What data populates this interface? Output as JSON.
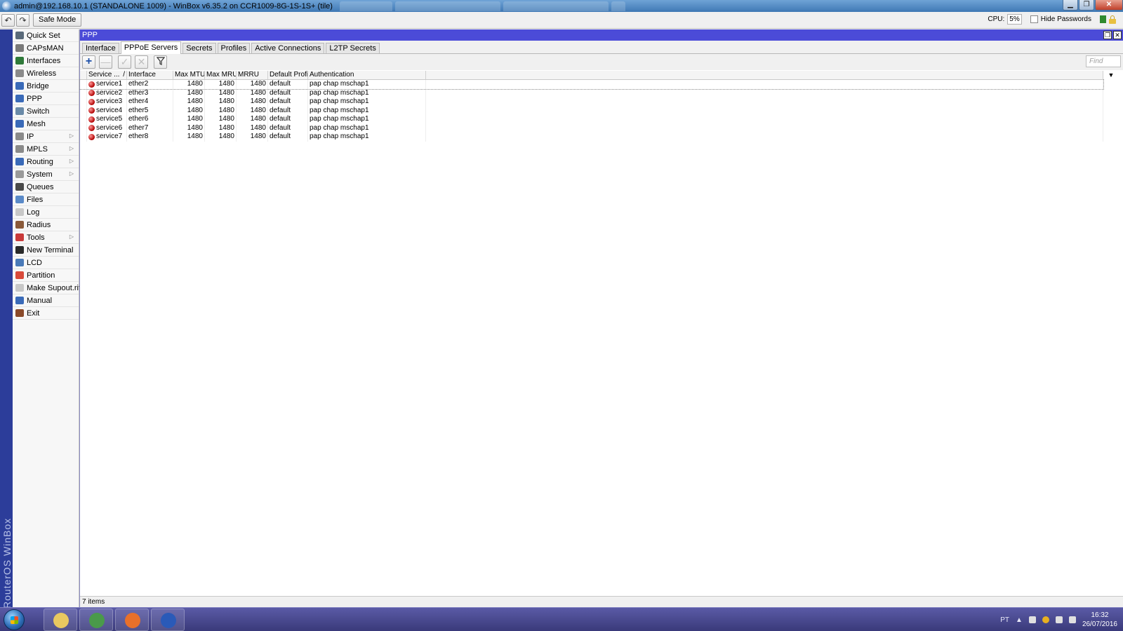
{
  "window": {
    "title": "admin@192.168.10.1 (STANDALONE 1009) - WinBox v6.35.2 on CCR1009-8G-1S-1S+ (tile)",
    "controls": {
      "minimize": "▁",
      "maximize": "❐",
      "close": "✕"
    }
  },
  "toolbar": {
    "undo": "↶",
    "redo": "↷",
    "safe_mode": "Safe Mode",
    "cpu_label": "CPU:",
    "cpu_value": "5%",
    "hide_passwords": "Hide Passwords"
  },
  "brand": "RouterOS WinBox",
  "sidebar": {
    "items": [
      {
        "label": "Quick Set",
        "icon": "quick-set-icon",
        "color": "#5a6a7a"
      },
      {
        "label": "CAPsMAN",
        "icon": "capsman-icon",
        "color": "#7a7a7a"
      },
      {
        "label": "Interfaces",
        "icon": "interfaces-icon",
        "color": "#2f7a3a"
      },
      {
        "label": "Wireless",
        "icon": "wireless-icon",
        "color": "#8a8a8a"
      },
      {
        "label": "Bridge",
        "icon": "bridge-icon",
        "color": "#3a6ab8"
      },
      {
        "label": "PPP",
        "icon": "ppp-icon",
        "color": "#3a6ab8"
      },
      {
        "label": "Switch",
        "icon": "switch-icon",
        "color": "#6a8aa8"
      },
      {
        "label": "Mesh",
        "icon": "mesh-icon",
        "color": "#3a6ab8"
      },
      {
        "label": "IP",
        "icon": "ip-icon",
        "color": "#8a8a8a",
        "arrow": "▷"
      },
      {
        "label": "MPLS",
        "icon": "mpls-icon",
        "color": "#8a8a8a",
        "arrow": "▷"
      },
      {
        "label": "Routing",
        "icon": "routing-icon",
        "color": "#3a6ab8",
        "arrow": "▷"
      },
      {
        "label": "System",
        "icon": "system-icon",
        "color": "#9a9a9a",
        "arrow": "▷"
      },
      {
        "label": "Queues",
        "icon": "queues-icon",
        "color": "#4a4a4a"
      },
      {
        "label": "Files",
        "icon": "files-icon",
        "color": "#5a8ac8"
      },
      {
        "label": "Log",
        "icon": "log-icon",
        "color": "#c8c8c8"
      },
      {
        "label": "Radius",
        "icon": "radius-icon",
        "color": "#8a5a3a"
      },
      {
        "label": "Tools",
        "icon": "tools-icon",
        "color": "#c83a3a",
        "arrow": "▷"
      },
      {
        "label": "New Terminal",
        "icon": "terminal-icon",
        "color": "#2a2a2a"
      },
      {
        "label": "LCD",
        "icon": "lcd-icon",
        "color": "#4a7ab8"
      },
      {
        "label": "Partition",
        "icon": "partition-icon",
        "color": "#d84a3a"
      },
      {
        "label": "Make Supout.rif",
        "icon": "supout-icon",
        "color": "#c8c8c8"
      },
      {
        "label": "Manual",
        "icon": "manual-icon",
        "color": "#3a6ab8"
      },
      {
        "label": "Exit",
        "icon": "exit-icon",
        "color": "#8a4a2a"
      }
    ]
  },
  "ppp": {
    "title": "PPP",
    "tabs": [
      "Interface",
      "PPPoE Servers",
      "Secrets",
      "Profiles",
      "Active Connections",
      "L2TP Secrets"
    ],
    "active_tab": 1,
    "actions": {
      "add": "+",
      "remove": "—",
      "enable": "✓",
      "disable": "✕",
      "filter": "⚲"
    },
    "find_placeholder": "Find",
    "columns": [
      "Service ...",
      "Interface",
      "Max MTU",
      "Max MRU",
      "MRRU",
      "Default Profile",
      "Authentication"
    ],
    "sort_mark": "/",
    "rows": [
      {
        "service": "service1",
        "interface": "ether2",
        "mtu": "1480",
        "mru": "1480",
        "mrru": "1480",
        "profile": "default",
        "auth": "pap chap mschap1"
      },
      {
        "service": "service2",
        "interface": "ether3",
        "mtu": "1480",
        "mru": "1480",
        "mrru": "1480",
        "profile": "default",
        "auth": "pap chap mschap1"
      },
      {
        "service": "service3",
        "interface": "ether4",
        "mtu": "1480",
        "mru": "1480",
        "mrru": "1480",
        "profile": "default",
        "auth": "pap chap mschap1"
      },
      {
        "service": "service4",
        "interface": "ether5",
        "mtu": "1480",
        "mru": "1480",
        "mrru": "1480",
        "profile": "default",
        "auth": "pap chap mschap1"
      },
      {
        "service": "service5",
        "interface": "ether6",
        "mtu": "1480",
        "mru": "1480",
        "mrru": "1480",
        "profile": "default",
        "auth": "pap chap mschap1"
      },
      {
        "service": "service6",
        "interface": "ether7",
        "mtu": "1480",
        "mru": "1480",
        "mrru": "1480",
        "profile": "default",
        "auth": "pap chap mschap1"
      },
      {
        "service": "service7",
        "interface": "ether8",
        "mtu": "1480",
        "mru": "1480",
        "mrru": "1480",
        "profile": "default",
        "auth": "pap chap mschap1"
      }
    ],
    "status": "7 items"
  },
  "taskbar": {
    "apps": [
      {
        "name": "file-explorer-icon",
        "color": "#e8c860"
      },
      {
        "name": "chrome-icon",
        "color": "#4a9a4a"
      },
      {
        "name": "firefox-icon",
        "color": "#e8702a"
      },
      {
        "name": "winbox-icon",
        "color": "#2a5ab8"
      }
    ],
    "lang": "PT",
    "time": "16:32",
    "date": "26/07/2016"
  }
}
